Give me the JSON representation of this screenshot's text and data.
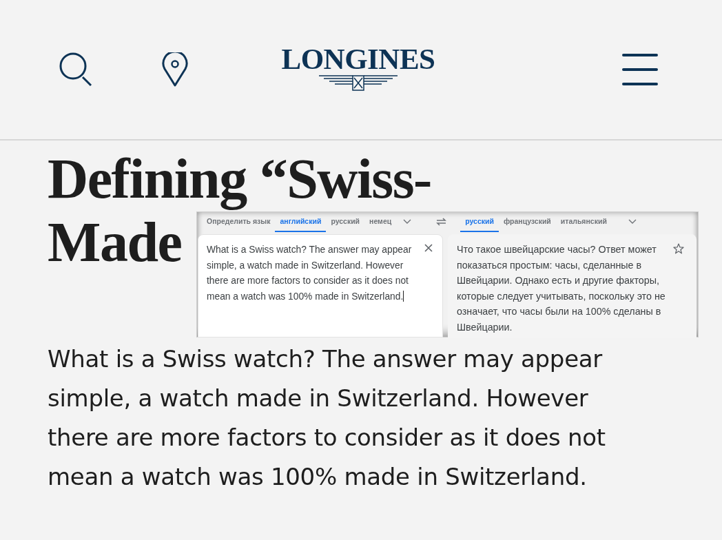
{
  "header": {
    "logo": "LONGINES"
  },
  "article": {
    "heading_lines": [
      "Defining “Swiss-",
      "Made"
    ],
    "intro": "What is a Swiss watch? The answer may appear simple, a watch made in Switzerland. However there are more factors to consider as it does not mean a watch was 100% made in Switzerland."
  },
  "translate_popup": {
    "source_languages": [
      {
        "label": "Определить язык",
        "selected": false
      },
      {
        "label": "английский",
        "selected": true
      },
      {
        "label": "русский",
        "selected": false
      },
      {
        "label": "немец",
        "selected": false
      }
    ],
    "target_languages": [
      {
        "label": "русский",
        "selected": true
      },
      {
        "label": "французский",
        "selected": false
      },
      {
        "label": "итальянский",
        "selected": false
      }
    ],
    "source_text": "What is a Swiss watch? The answer may appear simple, a watch made in Switzerland. However there are more factors to consider as it does not mean a watch was 100% made in Switzerland.",
    "translation": "Что такое швейцарские часы? Ответ может показаться простым: часы, сделанные в Швейцарии. Однако есть и другие факторы, которые следует учитывать, поскольку это не означает, что часы были на 100% сделаны в Швейцарии.",
    "starred": false
  }
}
